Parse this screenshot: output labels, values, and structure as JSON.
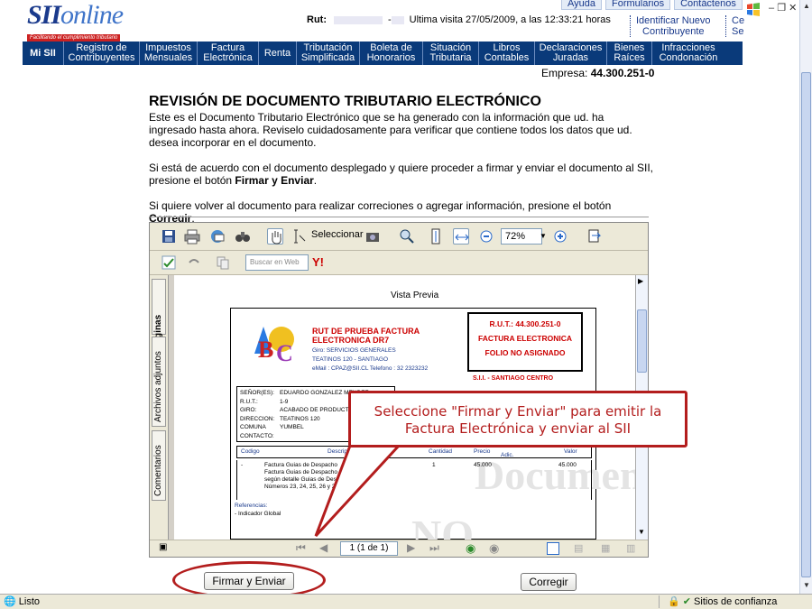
{
  "header": {
    "logo_main": "SII",
    "logo_accent": "online",
    "logo_tagline": "Facilitando el cumplimiento tributario",
    "top_menu": [
      "Ayuda",
      "Formularios",
      "Contáctenos"
    ],
    "rut_label": "Rut:",
    "rut_separator": "-",
    "last_visit": "Ultima visita 27/05/2009, a las 12:33:21 horas",
    "identify_line1": "Identificar Nuevo",
    "identify_line2": "Contribuyente",
    "clipped_link1": "Ce",
    "clipped_link2": "Se"
  },
  "nav": {
    "items": [
      {
        "l1": "Mi SII",
        "l2": ""
      },
      {
        "l1": "Registro de",
        "l2": "Contribuyentes"
      },
      {
        "l1": "Impuestos",
        "l2": "Mensuales"
      },
      {
        "l1": "Factura",
        "l2": "Electrónica"
      },
      {
        "l1": "Renta",
        "l2": ""
      },
      {
        "l1": "Tributación",
        "l2": "Simplificada"
      },
      {
        "l1": "Boleta de",
        "l2": "Honorarios"
      },
      {
        "l1": "Situación",
        "l2": "Tributaria"
      },
      {
        "l1": "Libros",
        "l2": "Contables"
      },
      {
        "l1": "Declaraciones",
        "l2": "Juradas"
      },
      {
        "l1": "Bienes",
        "l2": "Raíces"
      },
      {
        "l1": "Infracciones",
        "l2": "Condonación"
      }
    ]
  },
  "empresa_label": "Empresa:",
  "empresa_value": "44.300.251-0",
  "content": {
    "title": "REVISIÓN DE DOCUMENTO TRIBUTARIO ELECTRÓNICO",
    "p1": "Este es el Documento Tributario Electrónico que se ha generado con la información que ud. ha ingresado hasta ahora. Reviselo cuidadosamente para verificar que contiene todos los datos que ud. desea incorporar en el documento.",
    "p2_a": "Si está de acuerdo con el documento desplegado y quiere proceder a firmar y enviar el documento al SII, presione el botón ",
    "p2_b": "Firmar y Enviar",
    "p2_c": ".",
    "p3_a": "Si quiere volver al documento para realizar correciones o agregar información, presione el botón ",
    "p3_b": "Corregir",
    "p3_c": "."
  },
  "viewer": {
    "select_label": "Seleccionar",
    "zoom": "72%",
    "search_placeholder": "Buscar en Web",
    "tab_pages": "Páginas",
    "tab_attachments": "Archivos adjuntos",
    "tab_comments": "Comentarios",
    "page_indicator": "1 (1 de 1)"
  },
  "doc": {
    "preview_title": "Vista Previa",
    "company_name": "RUT DE PRUEBA FACTURA ELECTRONICA DR7",
    "company_giro": "Giro: SERVICIOS GENERALES",
    "company_addr": "TEATINOS 120 - SANTIAGO",
    "company_contact": "eMail : CPAZ@SII.CL Telefono : 32 2323232",
    "rut_box": "R.U.T.: 44.300.251-0",
    "doc_type": "FACTURA ELECTRONICA",
    "folio": "FOLIO NO ASIGNADO",
    "sii_office": "S.I.I. - SANTIAGO CENTRO",
    "client": [
      {
        "k": "SEÑOR(ES):",
        "v": "EDUARDO GONZALEZ MENDEZ"
      },
      {
        "k": "R.U.T.:",
        "v": "1-9"
      },
      {
        "k": "GIRO:",
        "v": "ACABADO DE PRODUCT"
      },
      {
        "k": "DIRECCION:",
        "v": "TEATINOS 120"
      },
      {
        "k": "COMUNA",
        "v": "YUMBEL"
      },
      {
        "k": "CONTACTO:",
        "v": ""
      }
    ],
    "col_codigo": "Codigo",
    "col_desc": "Descripcion",
    "col_cantidad": "Cantidad",
    "col_precio": "Precio",
    "col_adic": "Adic.",
    "col_valor": "Valor",
    "row_code": "-",
    "row_desc1": "Factura Guias de Despacho",
    "row_desc2": "Factura Guias de Despacho del 2009",
    "row_desc3": "según detalle Guias de Despacho",
    "row_desc4": "Números 23, 24, 25, 26 y 27",
    "row_qty": "1",
    "row_price": "45.000",
    "row_value": "45.000",
    "refs_label": "Referencias:",
    "refs_item": "- Indicador Global",
    "watermark1": "Documento",
    "watermark2": "NO"
  },
  "callout": {
    "line1": "Seleccione \"Firmar y Enviar\" para emitir la",
    "line2": "Factura Electrónica y enviar al SII"
  },
  "buttons": {
    "firmar": "Firmar y Enviar",
    "corregir": "Corregir"
  },
  "status": {
    "left": "Listo",
    "zone": "Sitios de confianza"
  },
  "colors": {
    "nav_bg": "#0a3a7a",
    "accent_red": "#b31d1d",
    "link_blue": "#1a3a8c"
  }
}
